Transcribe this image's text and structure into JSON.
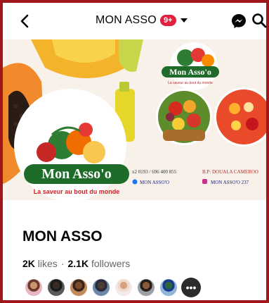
{
  "header": {
    "title": "MON ASSO",
    "badge": "9+"
  },
  "cover": {
    "logo_text": "Mon Asso'o",
    "tagline": "La saveur au bout du monde",
    "small_logo_text": "Mon Asso'o",
    "small_tagline": "La saveur au bout du monde",
    "phone": "x2 0193 / 696 400 855",
    "facebook_handle": "MON ASSO'O",
    "address": "B.P: DOUALA CAMEROO",
    "instagram_handle": "MON ASSO'O 237"
  },
  "profile": {
    "name": "MON ASSO",
    "likes_count": "2K",
    "likes_label": "likes",
    "separator": "·",
    "followers_count": "2.1K",
    "followers_label": "followers"
  },
  "friends": {
    "avatars": [
      "friend-1",
      "friend-2",
      "friend-3",
      "friend-4",
      "friend-5",
      "friend-6",
      "friend-7"
    ],
    "more_label": "•••"
  },
  "colors": {
    "frame": "#a0161b",
    "badge": "#e41e3f",
    "logo_green": "#1f6b2a",
    "logo_red": "#d11f26"
  }
}
